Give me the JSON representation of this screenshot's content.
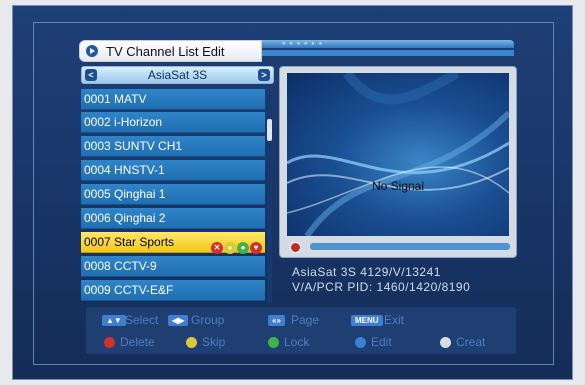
{
  "title": "TV Channel List Edit",
  "satellite": {
    "name": "AsiaSat 3S",
    "prev": "<",
    "next": ">"
  },
  "channels": [
    {
      "label": "0001 MATV"
    },
    {
      "label": "0002 i-Horizon"
    },
    {
      "label": "0003 SUNTV CH1"
    },
    {
      "label": "0004 HNSTV-1"
    },
    {
      "label": "0005 Qinghai 1"
    },
    {
      "label": "0006 Qinghai 2"
    },
    {
      "label": "0007 Star Sports",
      "selected": true
    },
    {
      "label": "0008 CCTV-9"
    },
    {
      "label": "0009 CCTV-E&F"
    }
  ],
  "channel_flag_icons": [
    "delete-mark-icon",
    "skip-mark-icon",
    "lock-mark-icon",
    "favorite-mark-icon"
  ],
  "preview": {
    "status": "No Signal"
  },
  "sat_info": {
    "line1": "AsiaSat 3S      4129/V/13241",
    "line2": "V/A/PCR PID: 1460/1420/8190"
  },
  "help": {
    "row1": [
      {
        "key": "▲▼",
        "label": "Select"
      },
      {
        "key": "◀▶",
        "label": "Group"
      },
      {
        "key": "«»",
        "label": "Page"
      },
      {
        "key": "MENU",
        "label": "Exit"
      }
    ],
    "row2": [
      {
        "color": "#d3302c",
        "label": "Delete"
      },
      {
        "color": "#d8c93a",
        "label": "Skip"
      },
      {
        "color": "#3fb24a",
        "label": "Lock"
      },
      {
        "color": "#3a7fd9",
        "label": "Edit"
      },
      {
        "color": "#d9dde3",
        "label": "Creat"
      }
    ]
  }
}
